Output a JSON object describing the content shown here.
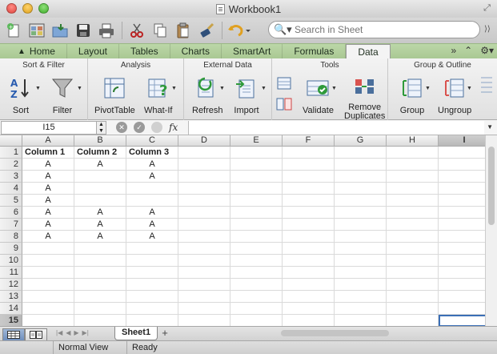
{
  "window": {
    "title": "Workbook1"
  },
  "toolbar": {
    "search_placeholder": "Search in Sheet"
  },
  "ribbon_tabs": [
    {
      "label": "Home"
    },
    {
      "label": "Layout"
    },
    {
      "label": "Tables"
    },
    {
      "label": "Charts"
    },
    {
      "label": "SmartArt"
    },
    {
      "label": "Formulas"
    },
    {
      "label": "Data",
      "active": true
    }
  ],
  "ribbon_groups": {
    "sort_filter": {
      "title": "Sort & Filter",
      "sort": "Sort",
      "filter": "Filter"
    },
    "analysis": {
      "title": "Analysis",
      "pivot": "PivotTable",
      "whatif": "What-If"
    },
    "external": {
      "title": "External Data",
      "refresh": "Refresh",
      "import": "Import"
    },
    "tools": {
      "title": "Tools",
      "validate": "Validate",
      "remove_line1": "Remove",
      "remove_line2": "Duplicates"
    },
    "group_outline": {
      "title": "Group & Outline",
      "group": "Group",
      "ungroup": "Ungroup"
    }
  },
  "formula_bar": {
    "name_box": "I15",
    "fx": "fx",
    "value": ""
  },
  "columns": [
    "A",
    "B",
    "C",
    "D",
    "E",
    "F",
    "G",
    "H",
    "I"
  ],
  "rows": [
    [
      "Column 1",
      "Column 2",
      "Column 3",
      "",
      "",
      "",
      "",
      "",
      ""
    ],
    [
      "A",
      "A",
      "A",
      "",
      "",
      "",
      "",
      "",
      ""
    ],
    [
      "A",
      "",
      "A",
      "",
      "",
      "",
      "",
      "",
      ""
    ],
    [
      "A",
      "",
      "",
      "",
      "",
      "",
      "",
      "",
      ""
    ],
    [
      "A",
      "",
      "",
      "",
      "",
      "",
      "",
      "",
      ""
    ],
    [
      "A",
      "A",
      "A",
      "",
      "",
      "",
      "",
      "",
      ""
    ],
    [
      "A",
      "A",
      "A",
      "",
      "",
      "",
      "",
      "",
      ""
    ],
    [
      "A",
      "A",
      "A",
      "",
      "",
      "",
      "",
      "",
      ""
    ],
    [
      "",
      "",
      "",
      "",
      "",
      "",
      "",
      "",
      ""
    ],
    [
      "",
      "",
      "",
      "",
      "",
      "",
      "",
      "",
      ""
    ],
    [
      "",
      "",
      "",
      "",
      "",
      "",
      "",
      "",
      ""
    ],
    [
      "",
      "",
      "",
      "",
      "",
      "",
      "",
      "",
      ""
    ],
    [
      "",
      "",
      "",
      "",
      "",
      "",
      "",
      "",
      ""
    ],
    [
      "",
      "",
      "",
      "",
      "",
      "",
      "",
      "",
      ""
    ],
    [
      "",
      "",
      "",
      "",
      "",
      "",
      "",
      "",
      ""
    ]
  ],
  "selected": {
    "row": 15,
    "col": "I"
  },
  "sheet_tabs": [
    {
      "label": "Sheet1",
      "active": true
    }
  ],
  "status": {
    "view": "Normal View",
    "state": "Ready"
  }
}
